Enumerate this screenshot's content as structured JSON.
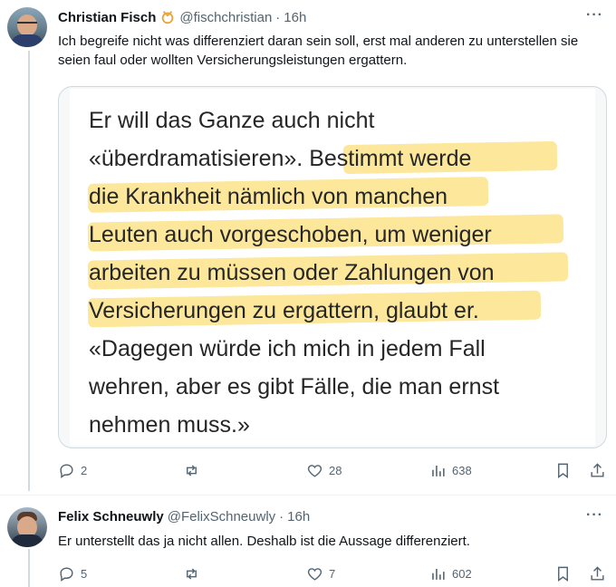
{
  "tweet1": {
    "name": "Christian Fisch",
    "handle": "@fischchristian",
    "separator": "·",
    "time": "16h",
    "more": "···",
    "text": "Ich begreife nicht was differenziert daran sein soll, erst mal anderen zu unterstellen sie seien faul oder wollten Versicherungsleistungen ergattern.",
    "image_text": [
      "Er will das Ganze auch nicht",
      "«überdramatisieren». Bestimmt werde",
      "die Krankheit nämlich von manchen",
      "Leuten auch vorgeschoben, um weniger",
      "arbeiten zu müssen oder Zahlungen von",
      "Versicherungen zu ergattern, glaubt er.",
      "«Dagegen würde ich mich in jedem Fall",
      "wehren, aber es gibt Fälle, die man ernst",
      "nehmen muss.»"
    ],
    "stats": {
      "replies": "2",
      "retweets": "",
      "likes": "28",
      "views": "638"
    }
  },
  "tweet2": {
    "name": "Felix Schneuwly",
    "handle": "@FelixSchneuwly",
    "separator": "·",
    "time": "16h",
    "more": "···",
    "text": "Er unterstellt das ja nicht allen. Deshalb ist die Aussage differenziert.",
    "stats": {
      "replies": "5",
      "retweets": "",
      "likes": "7",
      "views": "602"
    }
  },
  "colors": {
    "muted": "#536471",
    "text": "#0f1419",
    "highlight": "#fce38a",
    "border": "#cfd9de"
  },
  "icons": [
    "reply-icon",
    "retweet-icon",
    "like-icon",
    "views-icon",
    "bookmark-icon",
    "share-icon",
    "badge-icon",
    "more-icon"
  ]
}
